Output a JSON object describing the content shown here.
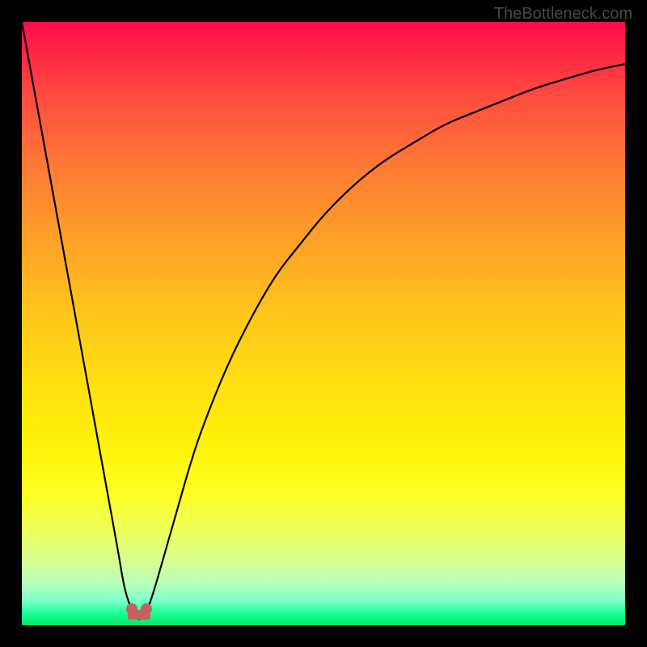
{
  "watermark": "TheBottleneck.com",
  "chart_data": {
    "type": "line",
    "title": "",
    "xlabel": "",
    "ylabel": "",
    "xlim": [
      0,
      100
    ],
    "ylim": [
      0,
      100
    ],
    "grid": false,
    "legend": false,
    "series": [
      {
        "name": "bottleneck-curve",
        "x": [
          0,
          2,
          4,
          6,
          8,
          10,
          12,
          14,
          16,
          17,
          18,
          19,
          20,
          21,
          22,
          24,
          26,
          28,
          30,
          34,
          38,
          42,
          46,
          50,
          55,
          60,
          65,
          70,
          75,
          80,
          85,
          90,
          95,
          100
        ],
        "y": [
          100,
          89,
          78,
          67,
          56,
          45,
          34,
          23,
          12,
          6,
          3,
          1,
          1,
          3,
          6,
          13,
          20,
          27,
          33,
          43,
          51,
          58,
          63,
          68,
          73,
          77,
          80,
          83,
          85,
          87,
          89,
          90.5,
          92,
          93
        ]
      }
    ],
    "optimum_marker": {
      "x": 19.5,
      "y": 1,
      "color": "#c56060"
    },
    "gradient": {
      "top": "#ff0b4a",
      "mid": "#fff208",
      "bottom": "#00e865"
    }
  }
}
